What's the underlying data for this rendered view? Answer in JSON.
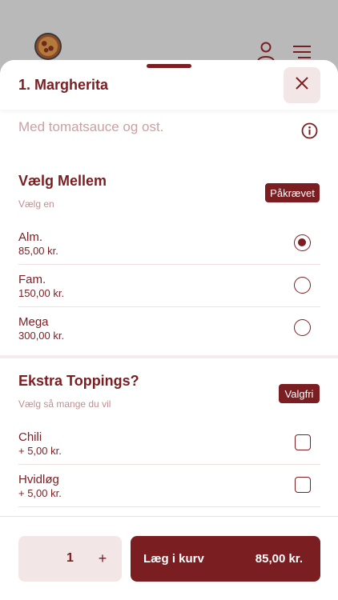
{
  "product": {
    "title": "1. Margherita",
    "description": "Med tomatsauce og ost."
  },
  "sections": {
    "size": {
      "title": "Vælg Mellem",
      "subtitle": "Vælg en",
      "badge": "Påkrævet",
      "options": [
        {
          "name": "Alm.",
          "price": "85,00 kr.",
          "selected": true
        },
        {
          "name": "Fam.",
          "price": "150,00 kr.",
          "selected": false
        },
        {
          "name": "Mega",
          "price": "300,00 kr.",
          "selected": false
        }
      ]
    },
    "toppings": {
      "title": "Ekstra Toppings?",
      "subtitle": "Vælg så mange du vil",
      "badge": "Valgfri",
      "options": [
        {
          "name": "Chili",
          "price": "+ 5,00 kr.",
          "checked": false
        },
        {
          "name": "Hvidløg",
          "price": "+ 5,00 kr.",
          "checked": false
        }
      ]
    }
  },
  "footer": {
    "quantity": "1",
    "plus": "+",
    "add_label": "Læg i kurv",
    "add_price": "85,00 kr."
  },
  "icons": {
    "close": "close-icon",
    "info": "info-icon",
    "user": "user-icon",
    "menu": "menu-icon",
    "logo": "pizza-logo"
  },
  "colors": {
    "accent": "#7a1e22",
    "accent_light": "#f3e6e6",
    "muted_text": "#c9a1a3"
  }
}
